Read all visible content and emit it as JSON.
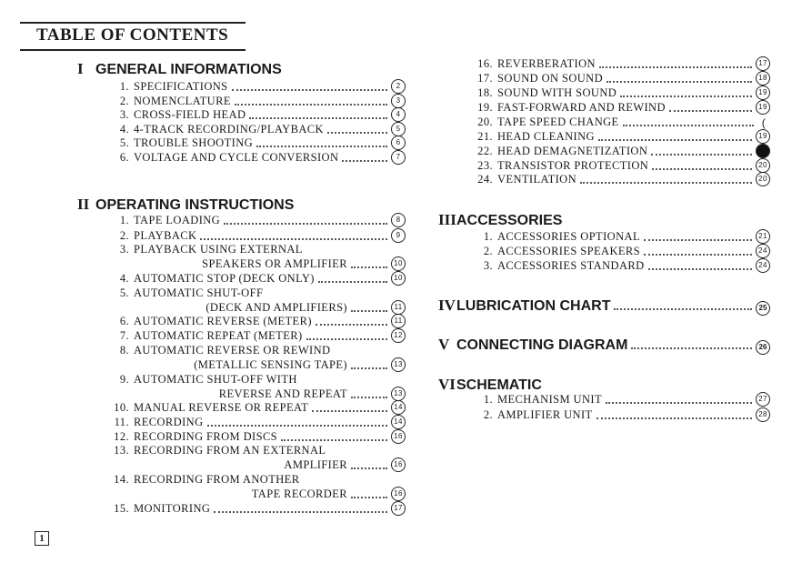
{
  "title": "TABLE OF CONTENTS",
  "page_number": "1",
  "sections": [
    {
      "numeral": "I",
      "heading": "GENERAL INFORMATIONS",
      "items": [
        {
          "num": "1.",
          "lines": [
            "SPECIFICATIONS"
          ],
          "page": "2"
        },
        {
          "num": "2.",
          "lines": [
            "NOMENCLATURE"
          ],
          "page": "3"
        },
        {
          "num": "3.",
          "lines": [
            "CROSS-FIELD HEAD"
          ],
          "page": "4"
        },
        {
          "num": "4.",
          "lines": [
            "4-TRACK RECORDING/PLAYBACK"
          ],
          "page": "5"
        },
        {
          "num": "5.",
          "lines": [
            "TROUBLE SHOOTING"
          ],
          "page": "6"
        },
        {
          "num": "6.",
          "lines": [
            "VOLTAGE AND CYCLE CONVERSION"
          ],
          "page": "7"
        }
      ]
    },
    {
      "numeral": "II",
      "heading": "OPERATING INSTRUCTIONS",
      "items": [
        {
          "num": "1.",
          "lines": [
            "TAPE LOADING"
          ],
          "page": "8"
        },
        {
          "num": "2.",
          "lines": [
            "PLAYBACK"
          ],
          "page": "9"
        },
        {
          "num": "3.",
          "lines": [
            "PLAYBACK USING EXTERNAL",
            "SPEAKERS OR AMPLIFIER"
          ],
          "page": "10"
        },
        {
          "num": "4.",
          "lines": [
            "AUTOMATIC STOP (DECK ONLY)"
          ],
          "page": "10"
        },
        {
          "num": "5.",
          "lines": [
            "AUTOMATIC SHUT-OFF",
            "(DECK AND AMPLIFIERS)"
          ],
          "page": "11"
        },
        {
          "num": "6.",
          "lines": [
            "AUTOMATIC REVERSE (METER)"
          ],
          "page": "11"
        },
        {
          "num": "7.",
          "lines": [
            "AUTOMATIC REPEAT (METER)"
          ],
          "page": "12"
        },
        {
          "num": "8.",
          "lines": [
            "AUTOMATIC REVERSE OR REWIND",
            "(METALLIC SENSING TAPE)"
          ],
          "page": "13"
        },
        {
          "num": "9.",
          "lines": [
            "AUTOMATIC SHUT-OFF WITH",
            "REVERSE AND REPEAT"
          ],
          "page": "13"
        },
        {
          "num": "10.",
          "lines": [
            "MANUAL REVERSE OR REPEAT"
          ],
          "page": "14"
        },
        {
          "num": "11.",
          "lines": [
            "RECORDING"
          ],
          "page": "14"
        },
        {
          "num": "12.",
          "lines": [
            "RECORDING FROM DISCS"
          ],
          "page": "16"
        },
        {
          "num": "13.",
          "lines": [
            "RECORDING FROM AN EXTERNAL",
            "AMPLIFIER"
          ],
          "page": "16"
        },
        {
          "num": "14.",
          "lines": [
            "RECORDING FROM ANOTHER",
            "TAPE RECORDER"
          ],
          "page": "16"
        },
        {
          "num": "15.",
          "lines": [
            "MONITORING"
          ],
          "page": "17"
        },
        {
          "num": "16.",
          "lines": [
            "REVERBERATION"
          ],
          "page": "17"
        },
        {
          "num": "17.",
          "lines": [
            "SOUND ON SOUND"
          ],
          "page": "18"
        },
        {
          "num": "18.",
          "lines": [
            "SOUND WITH SOUND"
          ],
          "page": "19"
        },
        {
          "num": "19.",
          "lines": [
            "FAST-FORWARD AND REWIND"
          ],
          "page": "19"
        },
        {
          "num": "20.",
          "lines": [
            "TAPE SPEED CHANGE"
          ],
          "page": "("
        },
        {
          "num": "21.",
          "lines": [
            "HEAD CLEANING"
          ],
          "page": "19"
        },
        {
          "num": "22.",
          "lines": [
            "HEAD DEMAGNETIZATION"
          ],
          "page": "●"
        },
        {
          "num": "23.",
          "lines": [
            "TRANSISTOR PROTECTION"
          ],
          "page": "20"
        },
        {
          "num": "24.",
          "lines": [
            "VENTILATION"
          ],
          "page": "20"
        }
      ]
    },
    {
      "numeral": "III",
      "heading": "ACCESSORIES",
      "items": [
        {
          "num": "1.",
          "lines": [
            "ACCESSORIES OPTIONAL"
          ],
          "page": "21"
        },
        {
          "num": "2.",
          "lines": [
            "ACCESSORIES SPEAKERS"
          ],
          "page": "24"
        },
        {
          "num": "3.",
          "lines": [
            "ACCESSORIES STANDARD"
          ],
          "page": "24"
        }
      ]
    },
    {
      "numeral": "IV",
      "heading": "LUBRICATION CHART",
      "page": "25",
      "items": []
    },
    {
      "numeral": "V",
      "heading": "CONNECTING DIAGRAM",
      "page": "26",
      "items": []
    },
    {
      "numeral": "VI",
      "heading": "SCHEMATIC",
      "items": [
        {
          "num": "1.",
          "lines": [
            "MECHANISM UNIT"
          ],
          "page": "27"
        },
        {
          "num": "2.",
          "lines": [
            "AMPLIFIER UNIT"
          ],
          "page": "28"
        }
      ]
    }
  ]
}
